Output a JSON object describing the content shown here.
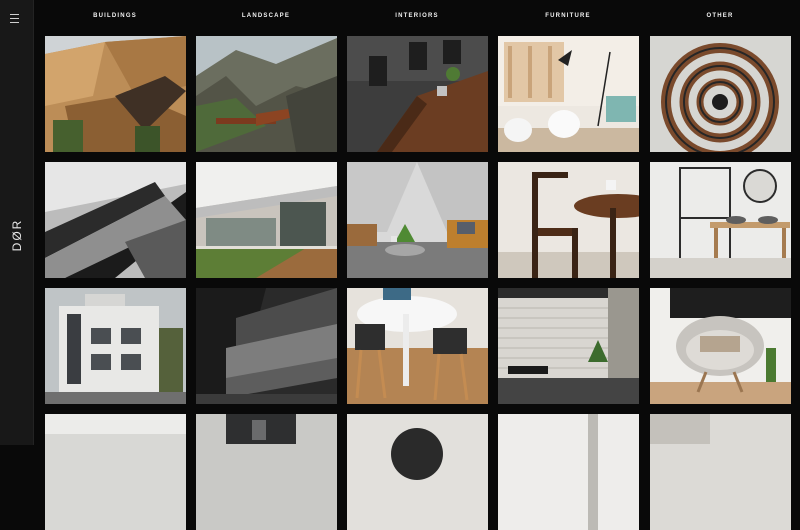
{
  "logo": "DØR",
  "nav": [
    "Buildings",
    "Landscape",
    "Interiors",
    "Furniture",
    "Other"
  ],
  "icons": {
    "menu": "hamburger-menu-icon"
  },
  "colors": {
    "background": "#090909",
    "sidebar": "#181818",
    "nav_text": "#f2f2f2"
  },
  "gallery": {
    "rows": [
      [
        {
          "name": "wood-panel-facade-photo"
        },
        {
          "name": "mountain-lookout-photo"
        },
        {
          "name": "wood-table-chairs-photo"
        },
        {
          "name": "white-lounge-chairs-photo"
        },
        {
          "name": "spiral-staircase-photo"
        }
      ],
      [
        {
          "name": "angular-concrete-photo"
        },
        {
          "name": "modern-house-deck-photo"
        },
        {
          "name": "living-room-sofa-photo"
        },
        {
          "name": "wooden-chair-table-photo"
        },
        {
          "name": "bathroom-sink-photo"
        }
      ],
      [
        {
          "name": "white-block-building-photo"
        },
        {
          "name": "stone-bench-photo"
        },
        {
          "name": "round-table-chairs-photo"
        },
        {
          "name": "brick-wall-interior-photo"
        },
        {
          "name": "egg-chair-photo"
        }
      ],
      [
        {
          "name": "partial-tile-1-photo"
        },
        {
          "name": "partial-tile-2-photo"
        },
        {
          "name": "partial-tile-3-photo"
        },
        {
          "name": "partial-tile-4-photo"
        },
        {
          "name": "partial-tile-5-photo"
        }
      ]
    ]
  }
}
